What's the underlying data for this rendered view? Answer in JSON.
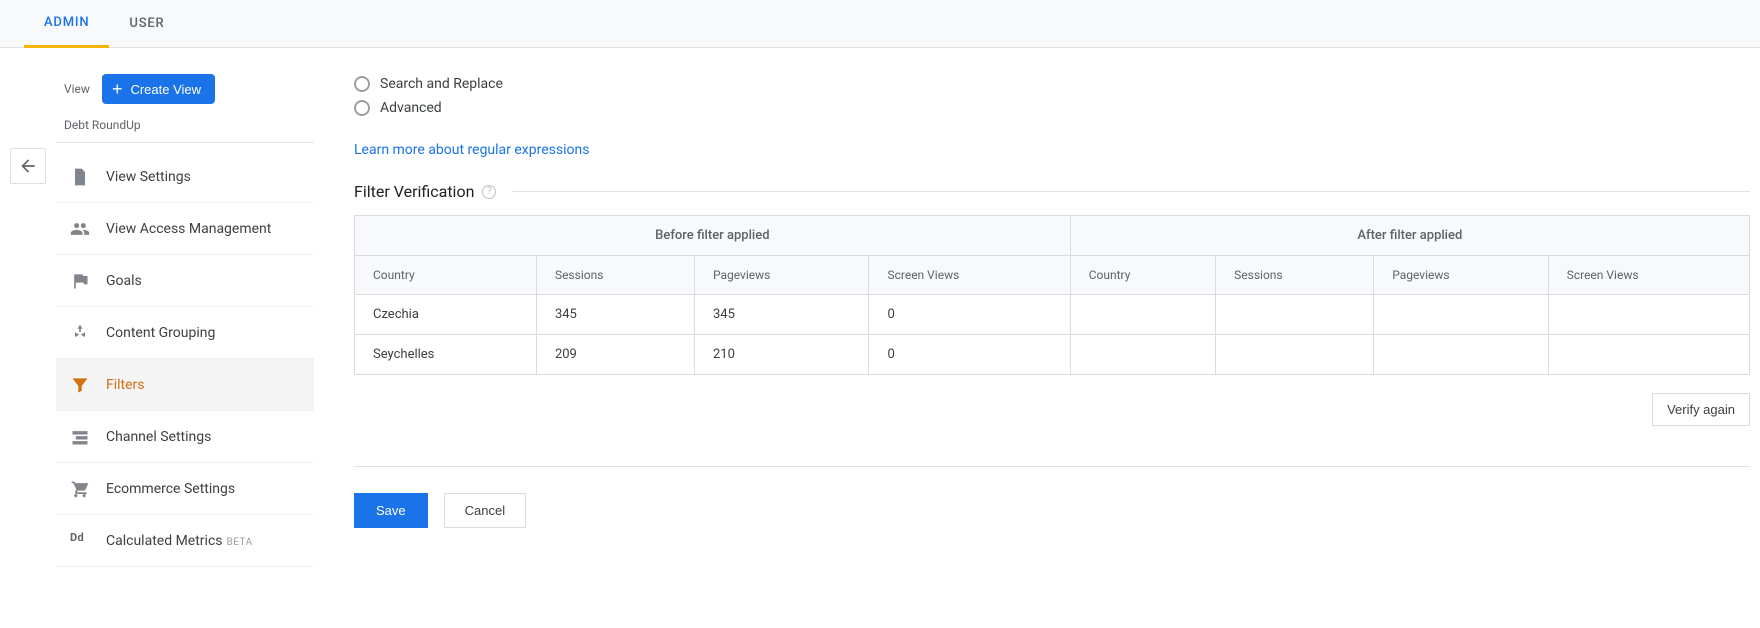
{
  "tabs": {
    "admin": "ADMIN",
    "user": "USER"
  },
  "sidebar": {
    "view_label": "View",
    "create_label": "Create View",
    "view_name": "Debt RoundUp",
    "items": [
      "View Settings",
      "View Access Management",
      "Goals",
      "Content Grouping",
      "Filters",
      "Channel Settings",
      "Ecommerce Settings",
      "Calculated Metrics"
    ],
    "beta_tag": "BETA"
  },
  "radios": {
    "search_replace": "Search and Replace",
    "advanced": "Advanced"
  },
  "learn_link": "Learn more about regular expressions",
  "section": {
    "title": "Filter Verification"
  },
  "table": {
    "group_before": "Before filter applied",
    "group_after": "After filter applied",
    "cols": [
      "Country",
      "Sessions",
      "Pageviews",
      "Screen Views",
      "Country",
      "Sessions",
      "Pageviews",
      "Screen Views"
    ],
    "rows": [
      {
        "c": [
          "Czechia",
          "345",
          "345",
          "0",
          "",
          "",
          "",
          ""
        ]
      },
      {
        "c": [
          "Seychelles",
          "209",
          "210",
          "0",
          "",
          "",
          "",
          ""
        ]
      }
    ]
  },
  "buttons": {
    "verify": "Verify again",
    "save": "Save",
    "cancel": "Cancel"
  }
}
